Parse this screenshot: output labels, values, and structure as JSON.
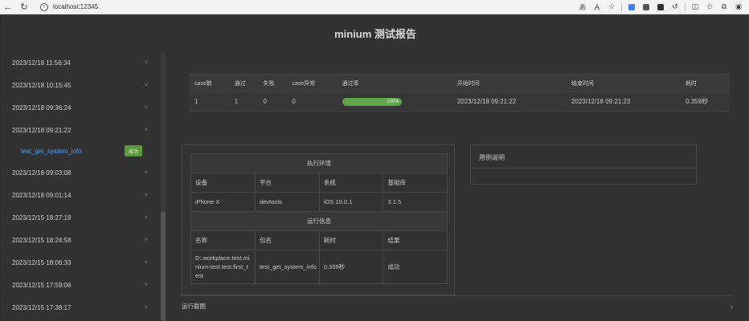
{
  "browser": {
    "url": "localhost:12345"
  },
  "page": {
    "title": "minium 测试报告"
  },
  "sidebar": {
    "items": [
      {
        "label": "2023/12/18 11:56:34",
        "chevron": "˅"
      },
      {
        "label": "2023/12/18 10:15:45",
        "chevron": "˅"
      },
      {
        "label": "2023/12/18 09:36:24",
        "chevron": "˅"
      },
      {
        "label": "2023/12/18 09:21:22",
        "chevron": "˄"
      },
      {
        "label": "2023/12/18 09:03:08",
        "chevron": "˅"
      },
      {
        "label": "2023/12/18 09:01:14",
        "chevron": "˅"
      },
      {
        "label": "2023/12/15 18:27:19",
        "chevron": "˅"
      },
      {
        "label": "2023/12/15 18:24:58",
        "chevron": "˅"
      },
      {
        "label": "2023/12/15 18:06:33",
        "chevron": "˅"
      },
      {
        "label": "2023/12/15 17:59:06",
        "chevron": "˅"
      },
      {
        "label": "2023/12/15 17:38:17",
        "chevron": "˅"
      }
    ],
    "sub_item": {
      "label": "test_get_system_info",
      "badge": "成功"
    }
  },
  "summary": {
    "headers": [
      "case数",
      "通过",
      "失败",
      "case异常",
      "通过率",
      "开始时间",
      "结束时间",
      "耗时"
    ],
    "row": {
      "cases": "1",
      "passed": "1",
      "failed": "0",
      "errors": "0",
      "pass_rate_label": "100%",
      "pass_rate": 1.0,
      "start": "2023/12/18 09:21:22",
      "end": "2023/12/18 09:21:23",
      "duration": "0.359秒"
    }
  },
  "env": {
    "title": "执行环境",
    "headers": [
      "设备",
      "平台",
      "系统",
      "基础库"
    ],
    "values": [
      "iPhone X",
      "devtools",
      "iOS 10.0.1",
      "3.1.5"
    ],
    "run_title": "运行信息",
    "run_headers": [
      "名称",
      "包名",
      "耗时",
      "结果"
    ],
    "run_name_lines": [
      "D:.workplace.test.mi",
      "nium-test.test.first_t",
      "est"
    ],
    "run_values": [
      "test_get_system_info",
      "0.359秒",
      "成功"
    ]
  },
  "case_desc": {
    "title": "用例说明"
  },
  "screenshots": {
    "label": "运行截图",
    "chevron": "›"
  },
  "colors": {
    "accent_link": "#4aa3ff",
    "success": "#5b9b3e",
    "progress": "#5ea64a"
  }
}
